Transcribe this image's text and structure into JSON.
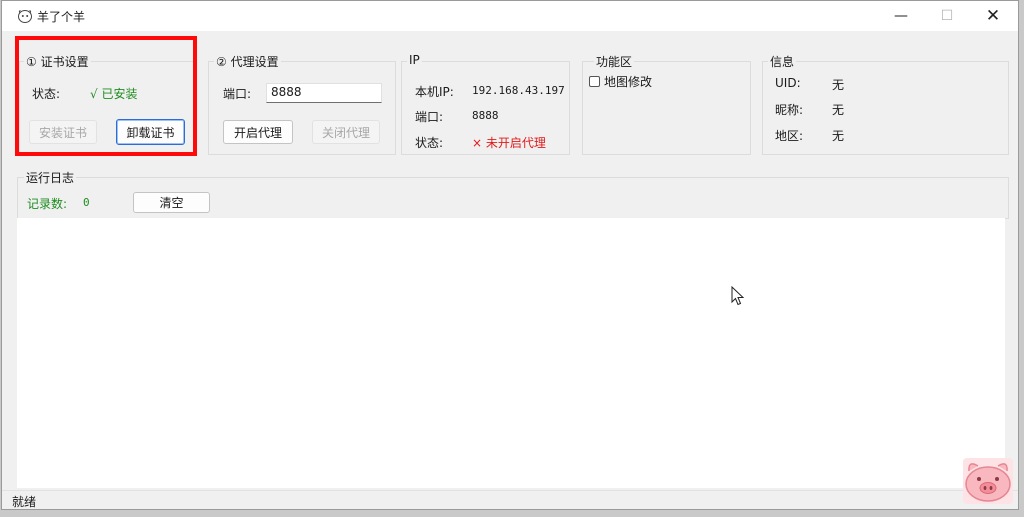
{
  "window": {
    "title": "羊了个羊",
    "minimize": "—",
    "maximize": "☐",
    "close": "✕"
  },
  "cert": {
    "title": "① 证书设置",
    "status_label": "状态:",
    "status_value": "√ 已安装",
    "install_btn": "安装证书",
    "uninstall_btn": "卸载证书"
  },
  "proxy": {
    "title": "② 代理设置",
    "port_label": "端口:",
    "port_value": "8888",
    "start_btn": "开启代理",
    "stop_btn": "关闭代理"
  },
  "ip": {
    "title": "IP",
    "local_ip_label": "本机IP:",
    "local_ip_value": "192.168.43.197",
    "port_label": "端口:",
    "port_value": "8888",
    "status_label": "状态:",
    "status_value": "× 未开启代理"
  },
  "features": {
    "title": "功能区",
    "map_edit_label": "地图修改",
    "map_edit_checked": false
  },
  "info": {
    "title": "信息",
    "uid_label": "UID:",
    "uid_value": "无",
    "nickname_label": "昵称:",
    "nickname_value": "无",
    "region_label": "地区:",
    "region_value": "无"
  },
  "log": {
    "title": "运行日志",
    "count_label": "记录数:",
    "count_value": "0",
    "clear_btn": "清空"
  },
  "statusbar": {
    "text": "就绪"
  },
  "colors": {
    "accent_red": "#ff0a0a",
    "success_green": "#1f8c1f",
    "error_red": "#e01b1b"
  }
}
